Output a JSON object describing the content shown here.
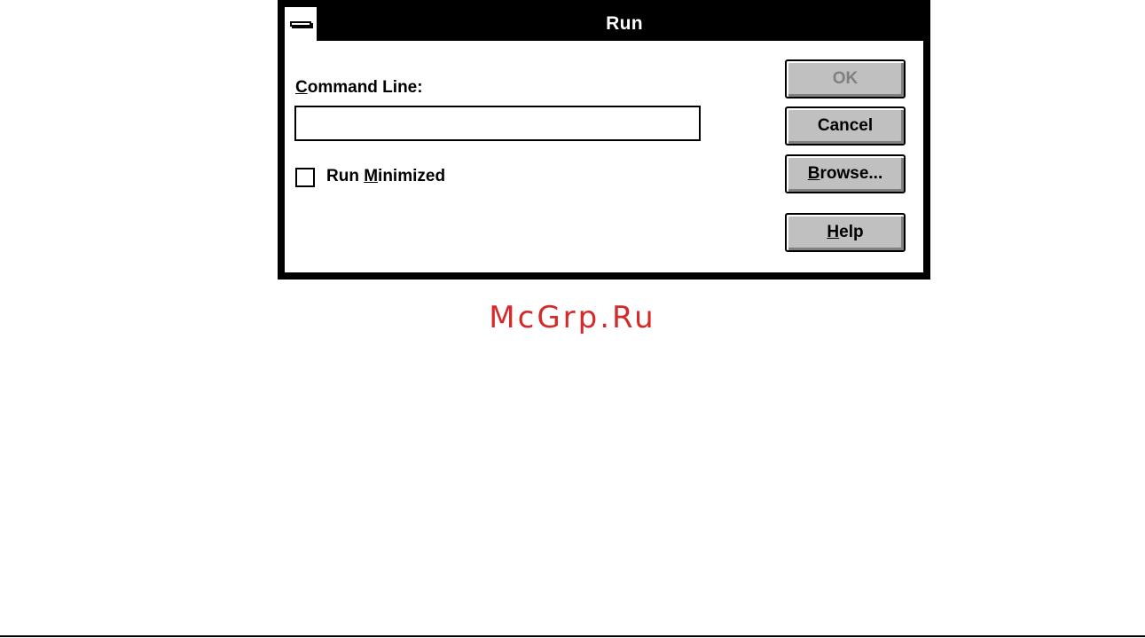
{
  "dialog": {
    "title": "Run",
    "command_label_mnemonic": "C",
    "command_label_rest": "ommand Line:",
    "command_value": "",
    "checkbox_pre": "Run ",
    "checkbox_mnemonic": "M",
    "checkbox_post": "inimized",
    "checkbox_checked": false
  },
  "buttons": {
    "ok": "OK",
    "cancel": "Cancel",
    "browse_mnemonic": "B",
    "browse_rest": "rowse...",
    "help_mnemonic": "H",
    "help_rest": "elp"
  },
  "watermark": "McGrp.Ru",
  "icons": {
    "system_menu": "system-menu-icon"
  },
  "colors": {
    "title_bar": "#000000",
    "button_face": "#c0c0c0",
    "watermark": "#d42a2a"
  }
}
